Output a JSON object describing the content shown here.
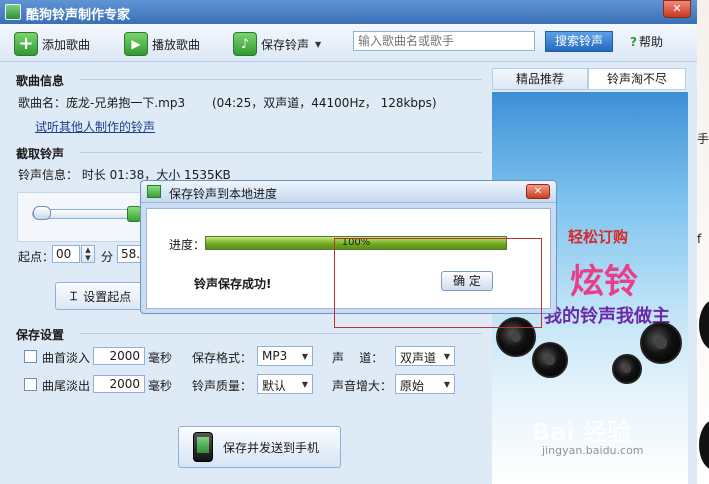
{
  "window": {
    "title": "酷狗铃声制作专家",
    "close_label": "✕"
  },
  "toolbar": {
    "add_label": "添加歌曲",
    "play_label": "播放歌曲",
    "save_label": "保存铃声",
    "search_placeholder": "输入歌曲名或歌手",
    "search_button": "搜索铃声",
    "help_label": "帮助"
  },
  "song_info": {
    "section_title": "歌曲信息",
    "name_label": "歌曲名：",
    "name_value": "庞龙-兄弟抱一下.mp3",
    "details": "(04:25，双声道，44100Hz，  128kbps)",
    "try_other_link": "试听其他人制作的铃声"
  },
  "clip": {
    "section_title": "截取铃声",
    "info_label": "铃声信息：",
    "info_value": "时长 01:38，大小  1535KB",
    "start_label": "起点：",
    "start_min": "00",
    "min_unit": "分",
    "start_sec": "58.",
    "set_start_button": "设置起点"
  },
  "save_settings": {
    "section_title": "保存设置",
    "fade_in_label": "曲首淡入",
    "fade_in_value": "2000",
    "fade_out_label": "曲尾淡出",
    "fade_out_value": "2000",
    "ms_unit": "毫秒",
    "format_label": "保存格式：",
    "format_value": "MP3",
    "channel_label": "声    道：",
    "channel_value": "双声道",
    "quality_label": "铃声质量：",
    "quality_value": "默认",
    "gain_label": "声音增大：",
    "gain_value": "原始",
    "save_send_button": "保存并发送到手机"
  },
  "right_panel": {
    "tabs": [
      "精品推荐",
      "铃声淘不尽"
    ],
    "ad_line1": "轻松订购",
    "ad_big": "炫铃",
    "ad_line2": "我的铃声我做主",
    "watermark": "Bai  经验",
    "watermark_sub": "jingyan.baidu.com"
  },
  "outer_edge": {
    "text_a": "手",
    "text_b": "f"
  },
  "dialog": {
    "title": "保存铃声到本地进度",
    "close_label": "✕",
    "progress_label": "进度：",
    "progress_value": 1.0,
    "progress_text": "100%",
    "success_text": "铃声保存成功!",
    "ok_button": "确  定"
  },
  "colors": {
    "title_bar": "#3a6fb6",
    "accent_blue": "#2468bd",
    "progress_green": "#6fa71f",
    "highlight_red": "#c0312b"
  }
}
